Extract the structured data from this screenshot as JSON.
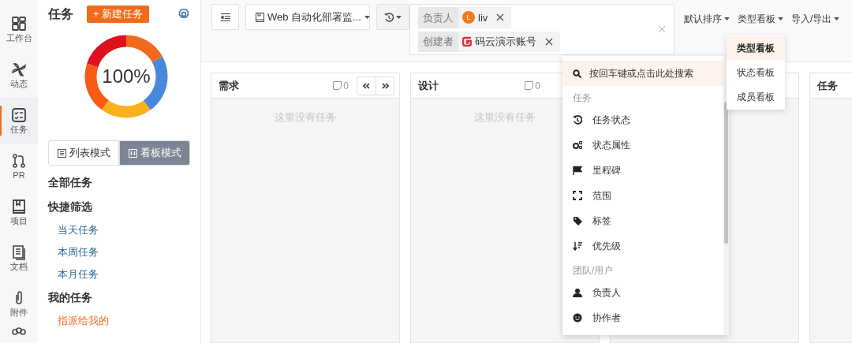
{
  "rail": [
    {
      "label": "工作台",
      "selected": false
    },
    {
      "label": "动态",
      "selected": false
    },
    {
      "label": "任务",
      "selected": true
    },
    {
      "label": "PR",
      "selected": false
    },
    {
      "label": "项目",
      "selected": false
    },
    {
      "label": "文档",
      "selected": false
    },
    {
      "label": "附件",
      "selected": false
    }
  ],
  "sidebar": {
    "title": "任务",
    "new_button": "+ 新建任务",
    "progress": "100%",
    "modes": [
      {
        "label": "列表模式",
        "selected": false
      },
      {
        "label": "看板模式",
        "selected": true
      }
    ],
    "items": [
      {
        "kind": "heading",
        "label": "全部任务"
      },
      {
        "kind": "heading",
        "label": "快捷筛选"
      },
      {
        "kind": "link",
        "label": "当天任务",
        "selected": false
      },
      {
        "kind": "link",
        "label": "本周任务",
        "selected": false
      },
      {
        "kind": "link",
        "label": "本月任务",
        "selected": false
      },
      {
        "kind": "heading",
        "label": "我的任务"
      },
      {
        "kind": "link",
        "label": "指派给我的",
        "selected": true
      }
    ]
  },
  "toolbar": {
    "project": "Web 自动化部署监...",
    "filters": [
      {
        "label": "负责人",
        "avatar_letter": "L",
        "value": "liv",
        "kind": "avatar"
      },
      {
        "label": "创建者",
        "value": "码云演示账号",
        "kind": "logo"
      }
    ],
    "menus": [
      "默认排序",
      "类型看板",
      "导入/导出"
    ]
  },
  "columns": [
    {
      "title": "需求",
      "count": "0",
      "empty": "这里没有任务",
      "nav_buttons": true
    },
    {
      "title": "设计",
      "count": "0",
      "empty": "这里没有任务",
      "nav_buttons": false
    },
    {},
    {
      "title": "任务"
    }
  ],
  "filter_menu": {
    "search": "按回车键或点击此处搜索",
    "items": [
      {
        "kind": "header",
        "label": "任务"
      },
      {
        "kind": "item",
        "label": "任务状态"
      },
      {
        "kind": "item",
        "label": "状态属性"
      },
      {
        "kind": "item",
        "label": "里程碑"
      },
      {
        "kind": "item",
        "label": "范围"
      },
      {
        "kind": "item",
        "label": "标签"
      },
      {
        "kind": "item",
        "label": "优先级"
      },
      {
        "kind": "header",
        "label": "团队/用户"
      },
      {
        "kind": "item",
        "label": "负责人"
      },
      {
        "kind": "item",
        "label": "协作者"
      }
    ]
  },
  "board_menu": [
    {
      "label": "类型看板",
      "selected": true
    },
    {
      "label": "状态看板",
      "selected": false
    },
    {
      "label": "成员看板",
      "selected": false
    }
  ]
}
